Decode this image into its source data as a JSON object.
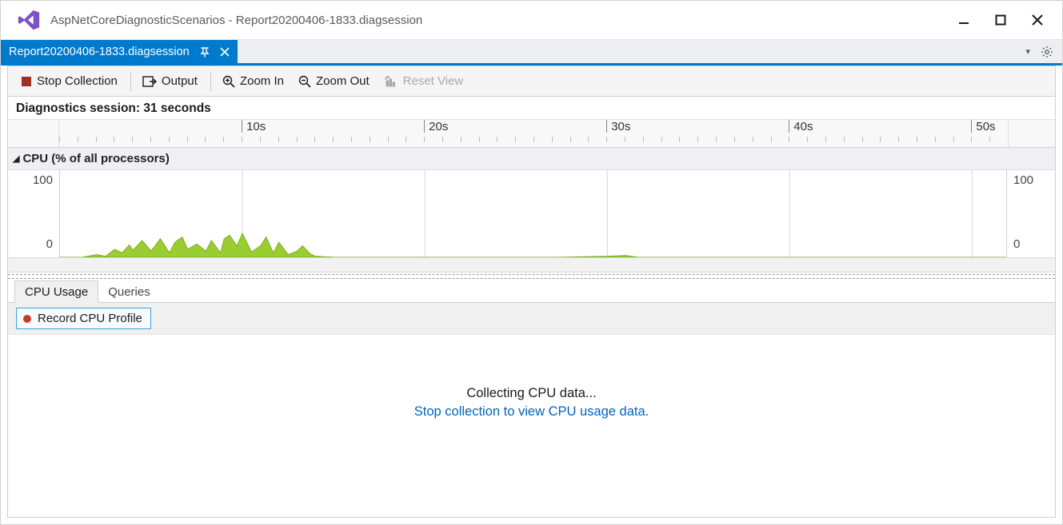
{
  "window": {
    "title": "AspNetCoreDiagnosticScenarios - Report20200406-1833.diagsession"
  },
  "tab": {
    "label": "Report20200406-1833.diagsession"
  },
  "toolbar": {
    "stop_collection": "Stop Collection",
    "output": "Output",
    "zoom_in": "Zoom In",
    "zoom_out": "Zoom Out",
    "reset_view": "Reset View"
  },
  "session": {
    "label": "Diagnostics session: 31 seconds",
    "seconds": 31
  },
  "ruler": {
    "major_ticks": [
      "10s",
      "20s",
      "30s",
      "40s",
      "50s"
    ],
    "visible_seconds": 52
  },
  "lane_cpu": {
    "title": "CPU (% of all processors)",
    "y_max": "100",
    "y_min": "0"
  },
  "bottom_tabs": {
    "cpu_usage": "CPU Usage",
    "queries": "Queries"
  },
  "record": {
    "button_label": "Record CPU Profile"
  },
  "main": {
    "collecting": "Collecting CPU data...",
    "hint": "Stop collection to view CPU usage data."
  },
  "chart_data": {
    "type": "area",
    "title": "CPU (% of all processors)",
    "xlabel": "seconds",
    "ylabel": "CPU %",
    "xlim": [
      0,
      52
    ],
    "ylim": [
      0,
      100
    ],
    "x": [
      0,
      1,
      2,
      2.5,
      3,
      3.4,
      3.8,
      4,
      4.5,
      5,
      5.5,
      6,
      6.3,
      6.7,
      7,
      7.5,
      8,
      8.3,
      8.8,
      9,
      9.3,
      9.7,
      10,
      10.5,
      11,
      11.3,
      11.7,
      12,
      12.5,
      13,
      13.3,
      13.7,
      14,
      15,
      20,
      25,
      30,
      31,
      32,
      52
    ],
    "values": [
      0,
      0,
      4,
      2,
      10,
      6,
      15,
      9,
      20,
      8,
      22,
      6,
      18,
      24,
      10,
      16,
      8,
      20,
      6,
      22,
      26,
      14,
      28,
      7,
      14,
      24,
      6,
      18,
      4,
      8,
      14,
      5,
      2,
      1,
      0,
      0,
      2,
      3,
      0,
      0
    ]
  }
}
